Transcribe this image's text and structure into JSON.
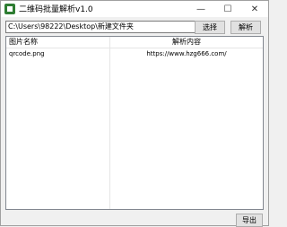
{
  "window": {
    "title": "二维码批量解析v1.0",
    "minimize_glyph": "—",
    "maximize_glyph": "☐",
    "close_glyph": "✕"
  },
  "path_input": {
    "value": "C:\\Users\\98222\\Desktop\\新建文件夹"
  },
  "buttons": {
    "select": "选择",
    "parse": "解析",
    "export": "导出"
  },
  "table": {
    "columns": [
      "图片名称",
      "解析内容"
    ],
    "rows": [
      {
        "name": "qrcode.png",
        "content": "https://www.hzg666.com/"
      }
    ]
  }
}
